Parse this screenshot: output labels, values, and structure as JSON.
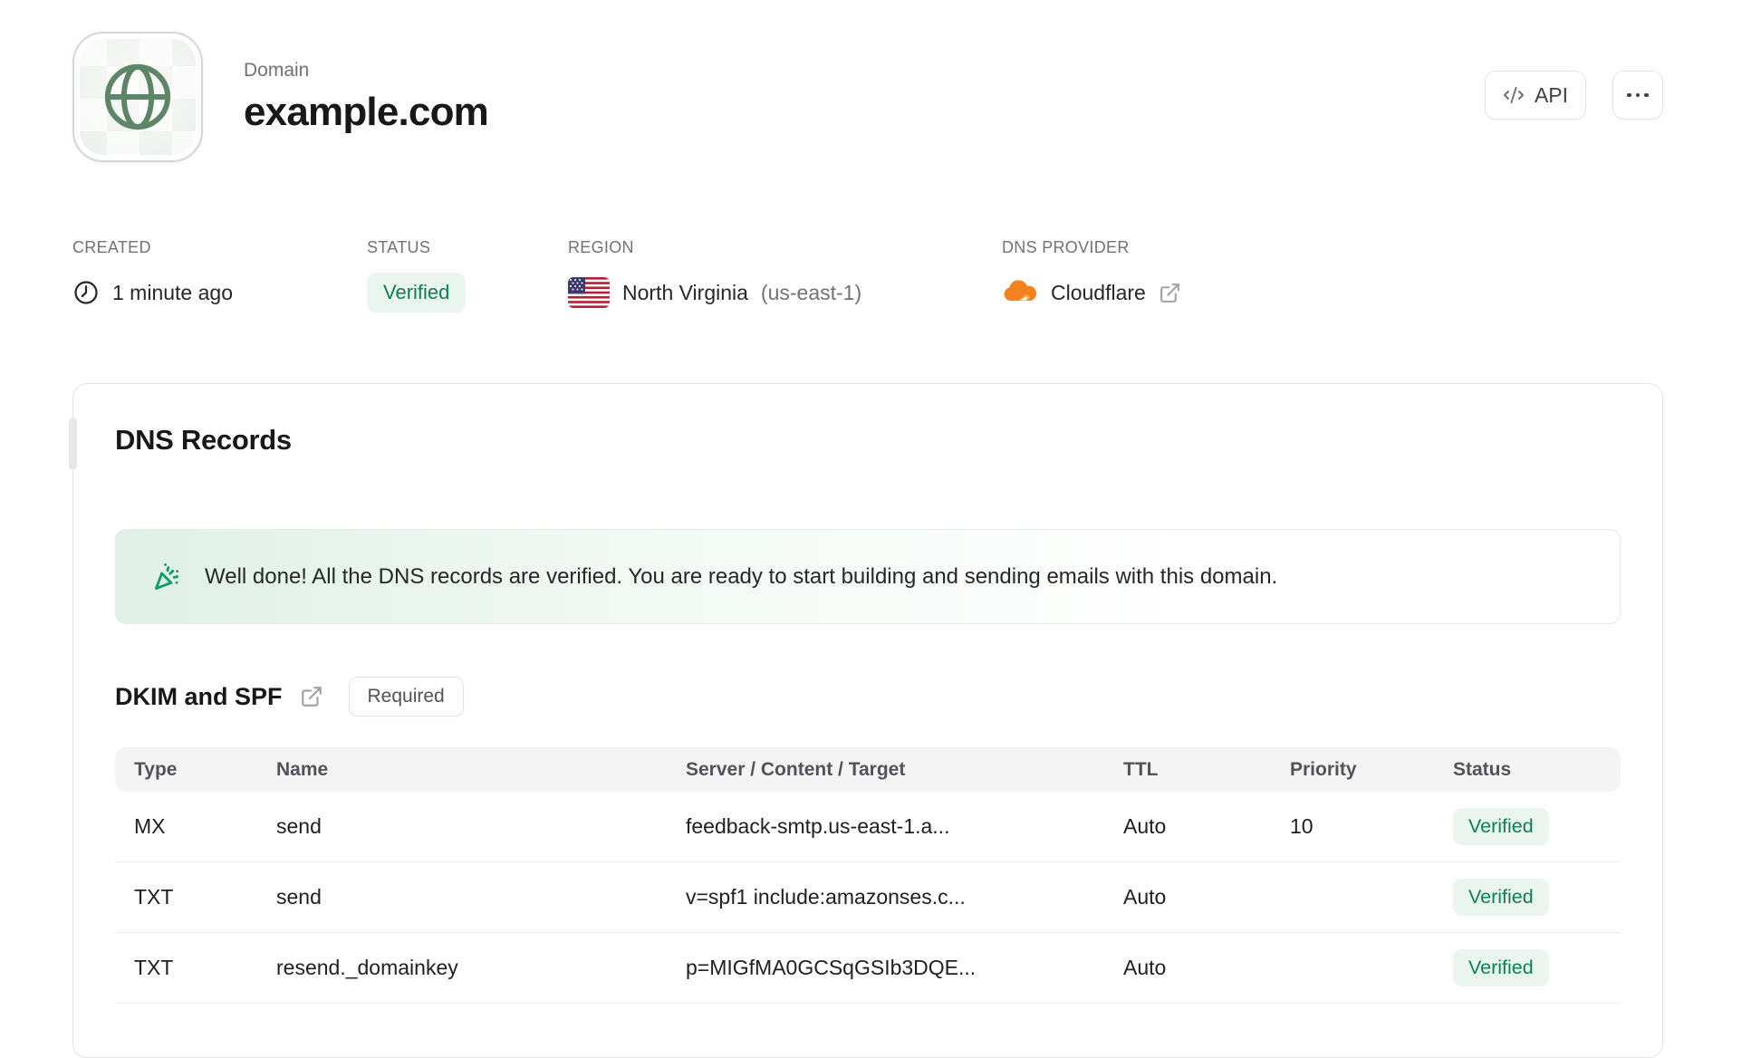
{
  "header": {
    "kicker": "Domain",
    "title": "example.com",
    "api_button_label": "API"
  },
  "meta": {
    "created": {
      "label": "CREATED",
      "value": "1 minute ago"
    },
    "status": {
      "label": "STATUS",
      "value": "Verified"
    },
    "region": {
      "label": "REGION",
      "value": "North Virginia",
      "code": "(us-east-1)"
    },
    "dns_provider": {
      "label": "DNS PROVIDER",
      "value": "Cloudflare"
    }
  },
  "dns_card": {
    "title": "DNS Records",
    "banner_message": "Well done! All the DNS records are verified. You are ready to start building and sending emails with this domain.",
    "section": {
      "title": "DKIM and SPF",
      "badge": "Required"
    },
    "table": {
      "headers": [
        "Type",
        "Name",
        "Server / Content / Target",
        "TTL",
        "Priority",
        "Status"
      ],
      "rows": [
        {
          "type": "MX",
          "name": "send",
          "content": "feedback-smtp.us-east-1.a...",
          "ttl": "Auto",
          "priority": "10",
          "status": "Verified"
        },
        {
          "type": "TXT",
          "name": "send",
          "content": "v=spf1 include:amazonses.c...",
          "ttl": "Auto",
          "priority": "",
          "status": "Verified"
        },
        {
          "type": "TXT",
          "name": "resend._domainkey",
          "content": "p=MIGfMA0GCSqGSIb3DQE...",
          "ttl": "Auto",
          "priority": "",
          "status": "Verified"
        }
      ]
    }
  },
  "icons": {
    "globe_icon": "globe",
    "code_icon": "</>",
    "ellipsis_icon": "...",
    "clock_icon": "clock",
    "us_flag_icon": "us-flag",
    "cloudflare_icon": "cloudflare-cloud",
    "external_link_icon": "external-link",
    "party_popper_icon": "party-popper"
  },
  "colors": {
    "verified_text": "#0b8050",
    "verified_bg": "#e9f5ee",
    "banner_green": "#dff0e6",
    "popper_green": "#0a9d63",
    "globe_green": "#5d8669",
    "cloudflare_orange": "#f48120",
    "cloudflare_orange_light": "#faad3f",
    "flag_red": "#b22234",
    "flag_blue": "#3c3b6e"
  }
}
